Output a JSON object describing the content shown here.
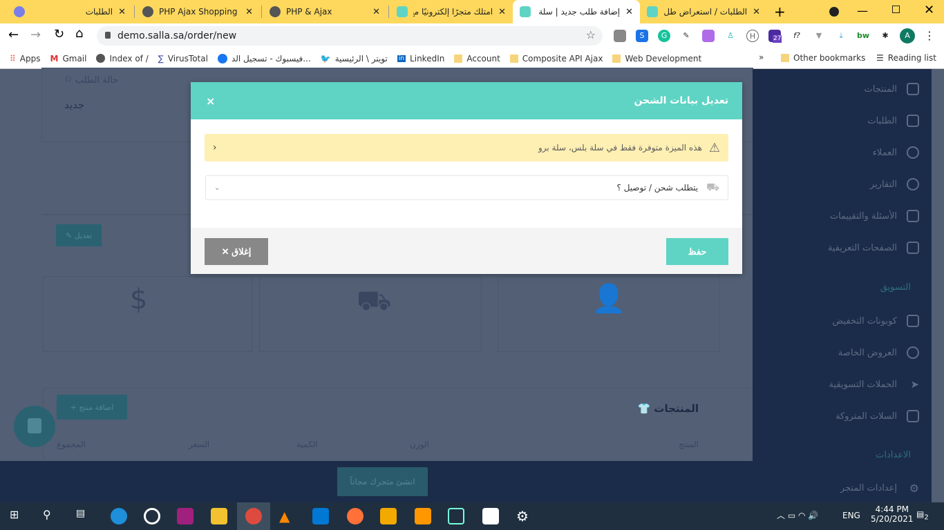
{
  "browser": {
    "tabs": [
      {
        "title": "الطلبات",
        "active": false
      },
      {
        "title": "PHP Ajax Shopping Ca",
        "active": false
      },
      {
        "title": "PHP & Ajax",
        "active": false
      },
      {
        "title": "امتلك متجرًا إلكترونيًا مع",
        "active": false
      },
      {
        "title": "إضافة طلب جديد | سلة",
        "active": true
      },
      {
        "title": "الطلبات / استعراض طل",
        "active": false
      }
    ],
    "new_tab": "+",
    "url": "demo.salla.sa/order/new",
    "profile_initial": "A",
    "ext_badge": "27",
    "bookmarks": [
      "Apps",
      "Gmail",
      "Index of /",
      "VirusTotal",
      "فيسبوك - تسجيل الد...",
      "تويتر \\ الرئيسية",
      "LinkedIn",
      "Account",
      "Composite API Ajax",
      "Web Development"
    ],
    "other_bookmarks": "Other bookmarks",
    "reading_list": "Reading list",
    "more": "»"
  },
  "page": {
    "order_status_label": "حالة الطلب",
    "order_status_value": "جديد",
    "edit_label": "تعديل",
    "products_title": "المنتجات",
    "add_product": "اضافة منتج",
    "table_headers": [
      "المنتج",
      "الوزن",
      "الكمية",
      "السعر",
      "المجموع"
    ],
    "create_store": "انشئ متجرك مجاناً"
  },
  "sidebar": {
    "items": [
      "المنتجات",
      "الطلبات",
      "العملاء",
      "التقارير",
      "الأسئلة والتقييمات",
      "الصفحات التعريفية"
    ],
    "marketing_heading": "التسويق",
    "marketing_items": [
      "كوبونات التخفيض",
      "العروض الخاصة",
      "الحملات التسويقية",
      "السلات المتروكة"
    ],
    "settings_heading": "الاعدادات",
    "settings_items": [
      "إعدادات المتجر"
    ]
  },
  "modal": {
    "title": "تعديل بيانات الشحن",
    "close_x": "×",
    "alert": "هذه الميزة متوفرة فقط في سلة بلس، سلة برو",
    "select_value": "يتطلب شحن / توصيل ؟",
    "save": "حفظ",
    "close": "إغلاق"
  },
  "taskbar": {
    "time": "4:44 PM",
    "date": "5/20/2021",
    "lang": "ENG",
    "notifications": "2"
  },
  "colors": {
    "accent": "#5fd4c4",
    "sidebar": "#1b2c4a",
    "tabbar": "#fdd85d",
    "alert": "#feefb3"
  }
}
